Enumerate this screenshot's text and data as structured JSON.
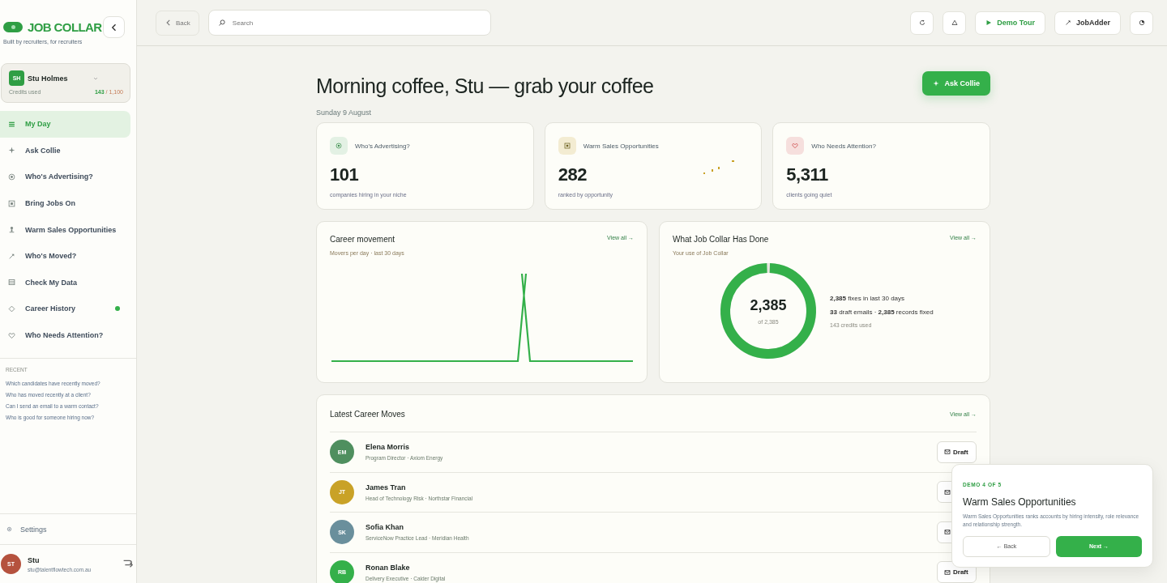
{
  "brand": {
    "name": "JOB COLLAR",
    "tagline": "Built by recruiters, for recruiters"
  },
  "account": {
    "initials": "SH",
    "name": "Stu Holmes",
    "credits_label": "Credits used",
    "credits_used": "143",
    "credits_total": "/ 1,100"
  },
  "nav": [
    {
      "label": "My Day",
      "selected": true,
      "dot": false
    },
    {
      "label": "Ask Collie",
      "selected": false,
      "dot": false
    },
    {
      "label": "Who's Advertising?",
      "selected": false,
      "dot": false
    },
    {
      "label": "Bring Jobs On",
      "selected": false,
      "dot": false
    },
    {
      "label": "Warm Sales Opportunities",
      "selected": false,
      "dot": false
    },
    {
      "label": "Who's Moved?",
      "selected": false,
      "dot": false
    },
    {
      "label": "Check My Data",
      "selected": false,
      "dot": false
    },
    {
      "label": "Career History",
      "selected": false,
      "dot": true
    },
    {
      "label": "Who Needs Attention?",
      "selected": false,
      "dot": false
    }
  ],
  "recent": {
    "title": "RECENT",
    "items": [
      "Which candidates have recently moved?",
      "Who has moved recently at a client?",
      "Can I send an email to a warm contact?",
      "Who is good for someone hiring now?"
    ]
  },
  "settings": "Settings",
  "user": {
    "initials": "ST",
    "name": "Stu",
    "email": "stu@talentflowtech.com.au"
  },
  "topbar": {
    "back": "Back",
    "search": {
      "placeholder": "Search"
    },
    "buttons": [
      {
        "kind": "icon"
      },
      {
        "kind": "icon"
      },
      {
        "kind": "primary",
        "label": "Demo Tour"
      },
      {
        "kind": "plain",
        "label": "JobAdder"
      },
      {
        "kind": "icon"
      }
    ]
  },
  "greeting": {
    "title": "Morning coffee, Stu — grab your coffee",
    "date": "Sunday 9 August",
    "action": "Ask Collie"
  },
  "stats": [
    {
      "label": "Who's Advertising?",
      "value": "101",
      "caption": "companies hiring in your niche",
      "sparkline": false
    },
    {
      "label": "Warm Sales Opportunities",
      "value": "282",
      "caption": "ranked by opportunity",
      "sparkline": true
    },
    {
      "label": "Who Needs Attention?",
      "value": "5,311",
      "caption": "clients going quiet",
      "sparkline": false
    }
  ],
  "career_movement": {
    "title": "Career movement",
    "subtitle": "Movers per day · last 30 days",
    "link": "View all →"
  },
  "activity": {
    "title": "What Job Collar Has Done",
    "subtitle": "Your use of Job Collar",
    "link": "View all →",
    "total": "2,385",
    "of": "of 2,385",
    "level": 1,
    "lines": [
      "**2,385** fixes in last 30 days",
      "**33** draft emails · **2,385** records fixed"
    ],
    "note": "143 credits used"
  },
  "moves": {
    "title": "Latest Career Moves",
    "link": "View all →",
    "rows": [
      {
        "initials": "EM",
        "color": "#4f8f5f",
        "name": "Elena Morris",
        "role": "Program Director · Axiom Energy",
        "action": "Draft"
      },
      {
        "initials": "JT",
        "color": "#c9a227",
        "name": "James Tran",
        "role": "Head of Technology Risk · Northstar Financial"
      },
      {
        "initials": "SK",
        "color": "#6a8f9c",
        "name": "Sofia Khan",
        "role": "ServiceNow Practice Lead · Meridian Health"
      },
      {
        "initials": "RB",
        "color": "#34b04a",
        "name": "Ronan Blake",
        "role": "Delivery Executive · Calder Digital",
        "action": "Draft"
      }
    ]
  },
  "tour": {
    "step": "DEMO 4 OF 5",
    "title": "Warm Sales Opportunities",
    "text": "Warm Sales Opportunities ranks accounts by hiring intensity, role relevance and relationship strength.",
    "back": "← Back",
    "next": "Next →"
  }
}
